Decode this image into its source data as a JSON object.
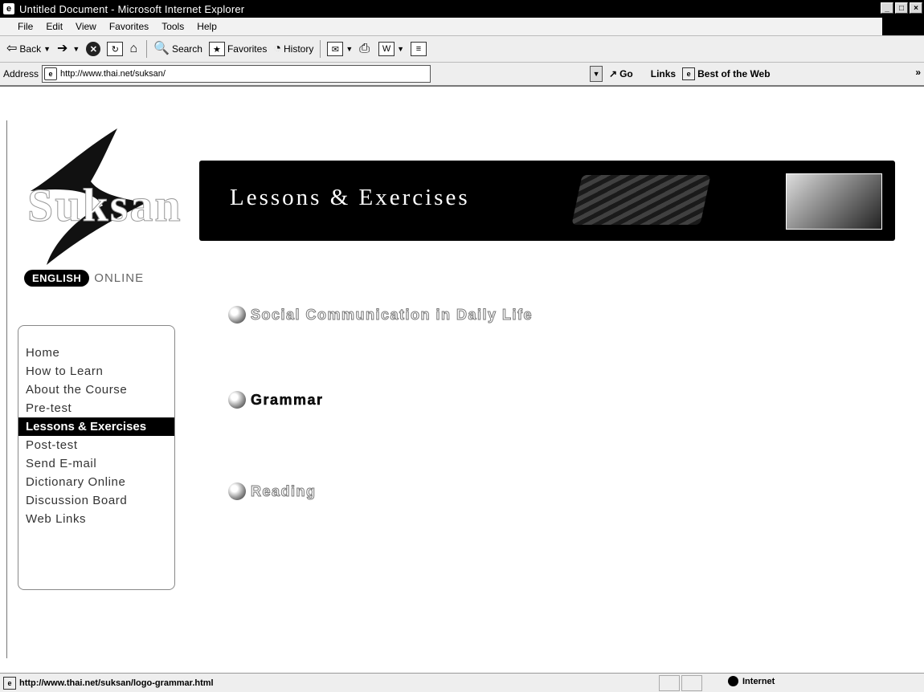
{
  "window": {
    "title": "Untitled Document - Microsoft Internet Explorer",
    "buttons": {
      "minimize": "_",
      "maximize": "□",
      "close": "×"
    }
  },
  "menu": [
    "File",
    "Edit",
    "View",
    "Favorites",
    "Tools",
    "Help"
  ],
  "toolbar": {
    "back": "Back",
    "search": "Search",
    "favorites": "Favorites",
    "history": "History"
  },
  "addressbar": {
    "label": "Address",
    "url": "http://www.thai.net/suksan/",
    "go": "Go",
    "links_label": "Links",
    "links_item": "Best of the Web",
    "more": "»"
  },
  "site": {
    "logo_text": "Suksan",
    "logo_badge": "ENGLISH",
    "logo_online": "ONLINE",
    "banner_title": "Lessons & Exercises"
  },
  "nav": {
    "items": [
      "Home",
      "How to Learn",
      "About the Course",
      "Pre-test",
      "Lessons & Exercises",
      "Post-test",
      "Send E-mail",
      "Dictionary Online",
      "Discussion Board",
      "Web Links"
    ],
    "active": "Lessons & Exercises"
  },
  "topics": [
    "Social Communication in Daily Life",
    "Grammar",
    "Reading"
  ],
  "statusbar": {
    "text": "http://www.thai.net/suksan/logo-grammar.html",
    "zone": "Internet"
  },
  "colors": {
    "chrome": "#eeeeee",
    "titlebar": "#000000",
    "banner": "#000000",
    "nav_active_bg": "#000000"
  }
}
